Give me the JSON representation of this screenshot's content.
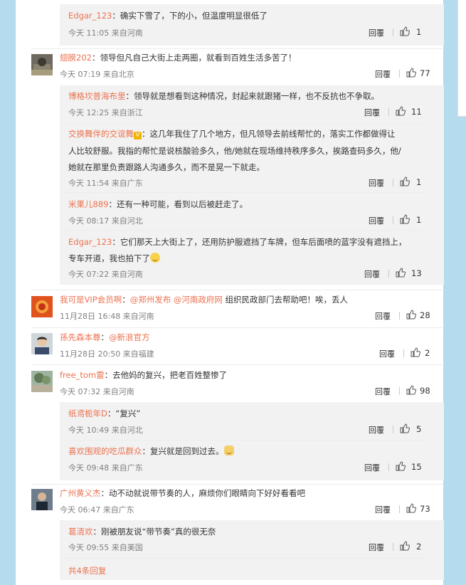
{
  "labels": {
    "reply": "回覆"
  },
  "colors": {
    "username": "#eb7350",
    "meta": "#808080",
    "reply_bg": "#f2f2f2",
    "page_bg": "#b5dbef"
  },
  "comments": [
    {
      "kind": "reply",
      "user": "Edgar_123",
      "text": "：确实下雪了，下的小，但温度明显很低了",
      "meta": "今天 11:05 来自河南",
      "likes": "1"
    },
    {
      "kind": "top",
      "user": "翅膀202",
      "text": "：领导但凡自己大街上走两圈，就看到百姓生活多苦了！",
      "meta": "今天 07:19 来自北京",
      "likes": "77"
    },
    {
      "kind": "reply",
      "user": "博格坎普海布里",
      "text": "：领导就是想看到这种情况，封起来就跟猪一样，也不反抗也不争取。",
      "meta": "今天 12:25 来自浙江",
      "likes": "11"
    },
    {
      "kind": "reply",
      "user": "交换舞伴的交谊舞",
      "line1": "：这几年我住了几个地方，但凡领导去前线帮忙的，落实工作都做得让",
      "line2": "人比较舒服。我指的帮忙是说核酸验多久，他/她就在现场维持秩序多久，挨路查码多久，他/",
      "line3": "她就在那里负责跟路人沟通多久，而不是晃一下就走。",
      "meta": "今天 11:54 来自广东",
      "likes": "1"
    },
    {
      "kind": "reply",
      "user": "米果儿889",
      "text": "：还有一种可能，看到以后被赶走了。",
      "meta": "今天 08:17 来自河北",
      "likes": "1"
    },
    {
      "kind": "reply",
      "user": "Edgar_123",
      "line1": "：它们那天上大街上了，还用防护服遮挡了车牌，但车后面喷的蓝字没有遮挡上，",
      "line2": "专车开道，我也拍下了",
      "meta": "今天 07:22 来自河南",
      "likes": "13"
    },
    {
      "kind": "top",
      "user": "我可是VIP会员啊",
      "mention1": "@郑州发布",
      "mention2": "@河南政府网",
      "text": " 组织民政部门去帮助吧！唉，丢人",
      "meta": "11月28日 16:48 来自河南",
      "likes": "28"
    },
    {
      "kind": "top",
      "user": "孫先森本尊",
      "mention1": "@新浪官方",
      "meta": "11月28日 20:50 来自福建",
      "likes": "2"
    },
    {
      "kind": "top",
      "user": "free_tom雷",
      "text": "：去他妈的复兴，把老百姓整惨了",
      "meta": "今天 07:32 来自河南",
      "likes": "98"
    },
    {
      "kind": "reply",
      "user": "纸鸢栀年D",
      "text": "：“复兴”",
      "meta": "今天 10:49 来自河北",
      "likes": "5"
    },
    {
      "kind": "reply",
      "user": "喜欢围观的吃瓜群众",
      "text": "：复兴就是回到过去。",
      "meta": "今天 09:48 来自广东",
      "likes": "15"
    },
    {
      "kind": "top",
      "user": "广州黄义杰",
      "text": "：动不动就说带节奏的人，麻烦你们眼睛向下好好看看吧",
      "meta": "今天 06:47 来自广东",
      "likes": "73"
    },
    {
      "kind": "reply",
      "user": "葛清欢",
      "text": "：刚被朋友说“带节奏”真的很无奈",
      "meta": "今天 09:55 来自美国",
      "likes": "2"
    }
  ],
  "more_replies": "共4条回复"
}
